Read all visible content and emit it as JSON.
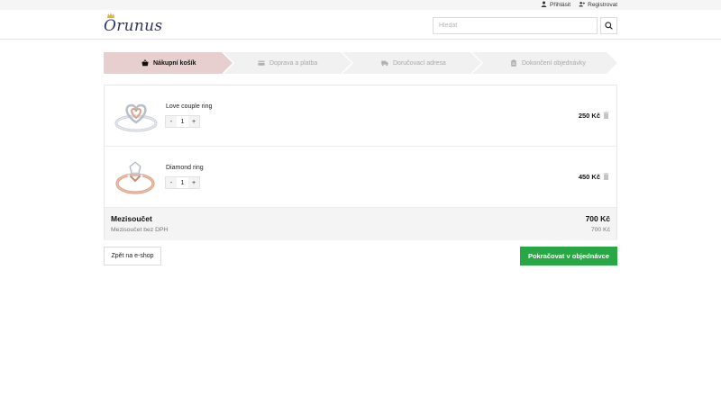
{
  "topbar": {
    "login_label": "Přihlásit",
    "register_label": "Registrovat"
  },
  "header": {
    "logo_text": "Orunus",
    "search": {
      "placeholder": "Hledat",
      "value": ""
    }
  },
  "steps": [
    {
      "label": "Nákupní košík",
      "icon": "basket-icon",
      "active": true
    },
    {
      "label": "Doprava a platba",
      "icon": "credit-card-icon",
      "active": false
    },
    {
      "label": "Doručovací adresa",
      "icon": "truck-icon",
      "active": false
    },
    {
      "label": "Dokončení objednávky",
      "icon": "clipboard-icon",
      "active": false
    }
  ],
  "cart": {
    "items": [
      {
        "name": "Love couple ring",
        "quantity": "1",
        "price": "250 Kč",
        "image": "silver-heart-ring"
      },
      {
        "name": "Diamond ring",
        "quantity": "1",
        "price": "450 Kč",
        "image": "rose-gold-diamond-ring"
      }
    ],
    "subtotal_label": "Mezisoučet",
    "subtotal_value": "700 Kč",
    "subtotal_excl_vat_label": "Mezisoučet bez DPH",
    "subtotal_excl_vat_value": "700 Kč"
  },
  "actions": {
    "back_label": "Zpět na e-shop",
    "continue_label": "Pokračovat v objednávce"
  },
  "colors": {
    "active_step": "#e8cfcf",
    "inactive_step": "#f1f1f1",
    "primary_button": "#28a745",
    "brand": "#2e3563"
  }
}
